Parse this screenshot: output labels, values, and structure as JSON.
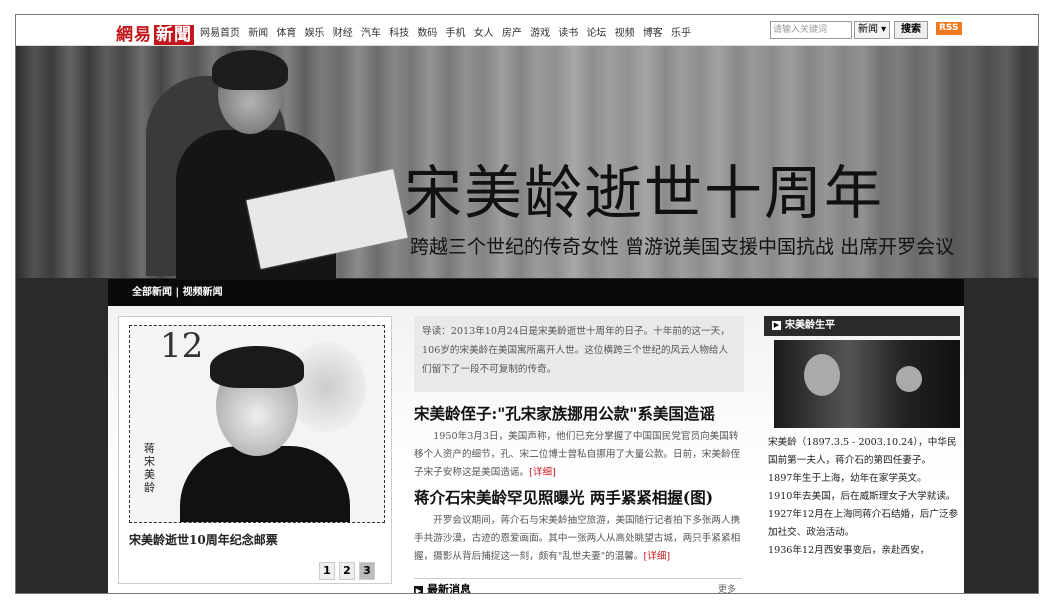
{
  "brand": {
    "name_part1": "網易",
    "name_part2": "新聞"
  },
  "nav": [
    "网易首页",
    "新闻",
    "体育",
    "娱乐",
    "财经",
    "汽车",
    "科技",
    "数码",
    "手机",
    "女人",
    "房产",
    "游戏",
    "读书",
    "论坛",
    "视频",
    "博客",
    "乐乎"
  ],
  "search": {
    "placeholder": "请输入关键词",
    "scope": "新闻 ▾",
    "button": "搜索",
    "rss": "RSS"
  },
  "hero": {
    "title": "宋美龄逝世十周年",
    "subtitle": "跨越三个世纪的传奇女性  曾游说美国支援中国抗战  出席开罗会议"
  },
  "channels": {
    "all": "全部新闻",
    "sep": " | ",
    "video": "视频新闻"
  },
  "stamp": {
    "number": "12",
    "vertical_text": "蒋宋美龄",
    "caption": "宋美龄逝世10周年纪念邮票",
    "pages": [
      "1",
      "2",
      "3"
    ],
    "active_page": "3"
  },
  "intro": "导读：2013年10月24日是宋美龄逝世十周年的日子。十年前的这一天，106岁的宋美龄在美国寓所离开人世。这位横跨三个世纪的风云人物给人们留下了一段不可复制的传奇。",
  "articles": [
    {
      "headline": "宋美龄侄子:\"孔宋家族挪用公款\"系美国造谣",
      "body": "1950年3月3日，美国声称，他们已充分掌握了中国国民党官员向美国转移个人资产的细节，孔、宋二位博士曾私自挪用了大量公款。日前，宋美龄侄子宋子安称这是美国造谣。",
      "more": "[详细]"
    },
    {
      "headline": "蒋介石宋美龄罕见照曝光 两手紧紧相握(图)",
      "body": "开罗会议期间，蒋介石与宋美龄抽空旅游，美国随行记者拍下多张两人携手共游沙漠，古迹的恩爱画面。其中一张两人从高处眺望古城，两只手紧紧相握，摄影从背后捕捉这一刻，颇有\"乱世夫妻\"的温馨。",
      "more": "[详细]"
    }
  ],
  "latest": {
    "label": "最新消息",
    "more": "更多"
  },
  "side": {
    "title": "宋美龄生平",
    "bio": [
      "宋美龄（1897.3.5 - 2003.10.24），中华民国前第一夫人，蒋介石的第四任妻子。",
      "1897年生于上海，幼年在家学英文。",
      "1910年去美国，后在威斯理女子大学就读。1927年12月在上海同蒋介石结婚，后广泛参加社交、政治活动。",
      "1936年12月西安事变后，亲赴西安，"
    ]
  }
}
